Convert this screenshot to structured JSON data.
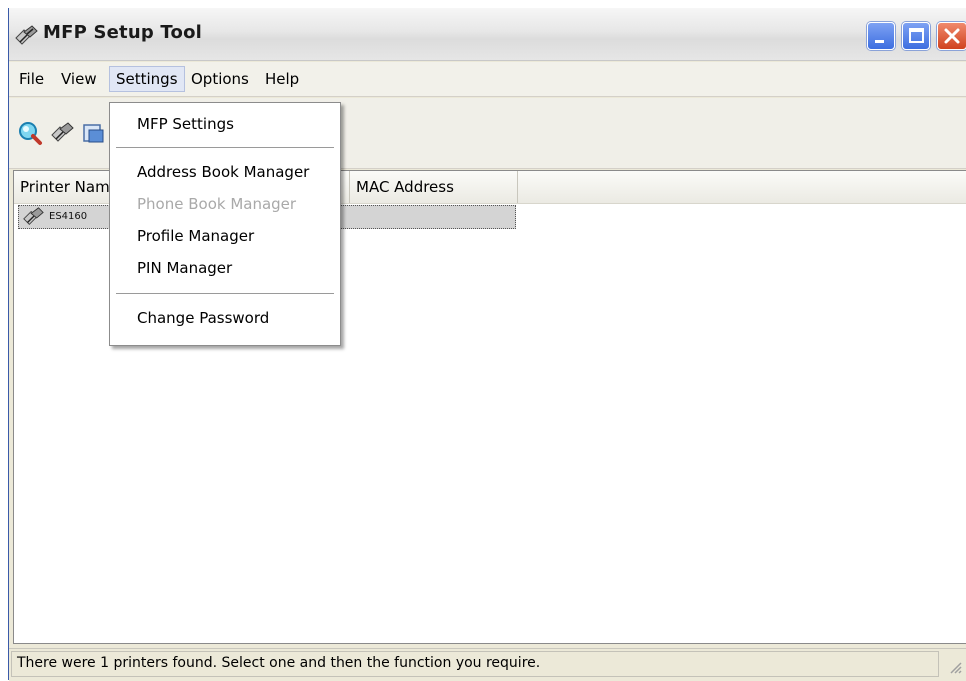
{
  "window": {
    "title": "MFP Setup Tool"
  },
  "menubar": {
    "items": [
      "File",
      "View",
      "Settings",
      "Options",
      "Help"
    ]
  },
  "toolbar": {
    "icons": [
      "search-icon",
      "printer-setup-icon",
      "printer-config-icon"
    ]
  },
  "list": {
    "columns": [
      "Printer Name",
      "MAC Address"
    ],
    "rows": [
      {
        "name": "ES4160"
      }
    ]
  },
  "settings_menu": {
    "items": [
      {
        "label": "MFP Settings",
        "enabled": true
      },
      {
        "label": "Address Book Manager",
        "enabled": true
      },
      {
        "label": "Phone Book Manager",
        "enabled": false
      },
      {
        "label": "Profile Manager",
        "enabled": true
      },
      {
        "label": "PIN Manager",
        "enabled": true
      },
      {
        "label": "Change Password",
        "enabled": true
      }
    ]
  },
  "status": {
    "message": "There were 1 printers found. Select one and then the function you require."
  }
}
